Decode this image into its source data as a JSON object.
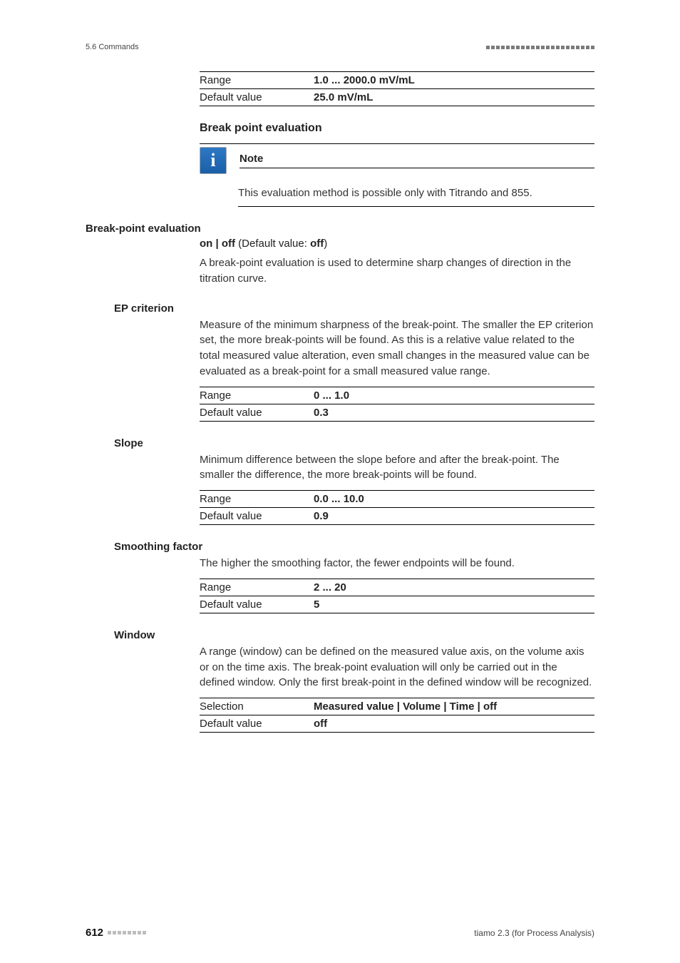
{
  "header": {
    "section": "5.6 Commands"
  },
  "range_block_top": {
    "range_label": "Range",
    "range_value": "1.0 ... 2000.0 mV/mL",
    "default_label": "Default value",
    "default_value": "25.0 mV/mL"
  },
  "break_point_eval_heading": "Break point evaluation",
  "note": {
    "title": "Note",
    "body": "This evaluation method is possible only with Titrando and 855."
  },
  "params": {
    "bpe": {
      "label": "Break-point evaluation",
      "options": "on | off",
      "default_word": " (Default value: ",
      "default_val": "off",
      "close": ")",
      "desc": "A break-point evaluation is used to determine sharp changes of direction in the titration curve."
    },
    "ep": {
      "label": "EP criterion",
      "desc": "Measure of the minimum sharpness of the break-point. The smaller the EP criterion set, the more break-points will be found. As this is a relative value related to the total measured value alteration, even small changes in the measured value can be evaluated as a break-point for a small measured value range.",
      "range_label": "Range",
      "range_value": "0 ... 1.0",
      "default_label": "Default value",
      "default_value": "0.3"
    },
    "slope": {
      "label": "Slope",
      "desc": "Minimum difference between the slope before and after the break-point. The smaller the difference, the more break-points will be found.",
      "range_label": "Range",
      "range_value": "0.0 ... 10.0",
      "default_label": "Default value",
      "default_value": "0.9"
    },
    "smoothing": {
      "label": "Smoothing factor",
      "desc": "The higher the smoothing factor, the fewer endpoints will be found.",
      "range_label": "Range",
      "range_value": "2 ... 20",
      "default_label": "Default value",
      "default_value": "5"
    },
    "window": {
      "label": "Window",
      "desc": "A range (window) can be defined on the measured value axis, on the volume axis or on the time axis. The break-point evaluation will only be carried out in the defined window. Only the first break-point in the defined window will be recognized.",
      "sel_label": "Selection",
      "sel_value": "Measured value | Volume | Time | off",
      "default_label": "Default value",
      "default_value": "off"
    }
  },
  "footer": {
    "page": "612",
    "right": "tiamo 2.3 (for Process Analysis)"
  }
}
